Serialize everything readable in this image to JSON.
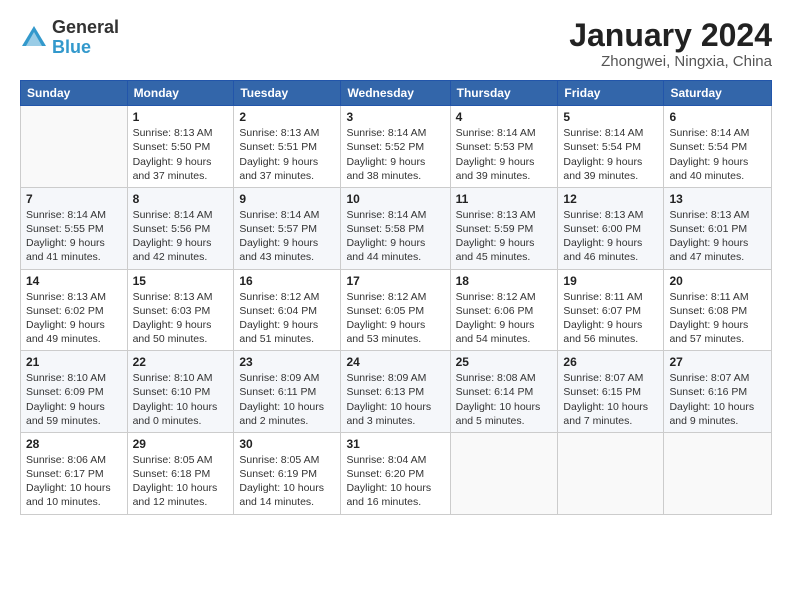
{
  "header": {
    "logo_general": "General",
    "logo_blue": "Blue",
    "title": "January 2024",
    "subtitle": "Zhongwei, Ningxia, China"
  },
  "weekdays": [
    "Sunday",
    "Monday",
    "Tuesday",
    "Wednesday",
    "Thursday",
    "Friday",
    "Saturday"
  ],
  "weeks": [
    [
      {
        "day": "",
        "info": ""
      },
      {
        "day": "1",
        "info": "Sunrise: 8:13 AM\nSunset: 5:50 PM\nDaylight: 9 hours\nand 37 minutes."
      },
      {
        "day": "2",
        "info": "Sunrise: 8:13 AM\nSunset: 5:51 PM\nDaylight: 9 hours\nand 37 minutes."
      },
      {
        "day": "3",
        "info": "Sunrise: 8:14 AM\nSunset: 5:52 PM\nDaylight: 9 hours\nand 38 minutes."
      },
      {
        "day": "4",
        "info": "Sunrise: 8:14 AM\nSunset: 5:53 PM\nDaylight: 9 hours\nand 39 minutes."
      },
      {
        "day": "5",
        "info": "Sunrise: 8:14 AM\nSunset: 5:54 PM\nDaylight: 9 hours\nand 39 minutes."
      },
      {
        "day": "6",
        "info": "Sunrise: 8:14 AM\nSunset: 5:54 PM\nDaylight: 9 hours\nand 40 minutes."
      }
    ],
    [
      {
        "day": "7",
        "info": "Sunrise: 8:14 AM\nSunset: 5:55 PM\nDaylight: 9 hours\nand 41 minutes."
      },
      {
        "day": "8",
        "info": "Sunrise: 8:14 AM\nSunset: 5:56 PM\nDaylight: 9 hours\nand 42 minutes."
      },
      {
        "day": "9",
        "info": "Sunrise: 8:14 AM\nSunset: 5:57 PM\nDaylight: 9 hours\nand 43 minutes."
      },
      {
        "day": "10",
        "info": "Sunrise: 8:14 AM\nSunset: 5:58 PM\nDaylight: 9 hours\nand 44 minutes."
      },
      {
        "day": "11",
        "info": "Sunrise: 8:13 AM\nSunset: 5:59 PM\nDaylight: 9 hours\nand 45 minutes."
      },
      {
        "day": "12",
        "info": "Sunrise: 8:13 AM\nSunset: 6:00 PM\nDaylight: 9 hours\nand 46 minutes."
      },
      {
        "day": "13",
        "info": "Sunrise: 8:13 AM\nSunset: 6:01 PM\nDaylight: 9 hours\nand 47 minutes."
      }
    ],
    [
      {
        "day": "14",
        "info": "Sunrise: 8:13 AM\nSunset: 6:02 PM\nDaylight: 9 hours\nand 49 minutes."
      },
      {
        "day": "15",
        "info": "Sunrise: 8:13 AM\nSunset: 6:03 PM\nDaylight: 9 hours\nand 50 minutes."
      },
      {
        "day": "16",
        "info": "Sunrise: 8:12 AM\nSunset: 6:04 PM\nDaylight: 9 hours\nand 51 minutes."
      },
      {
        "day": "17",
        "info": "Sunrise: 8:12 AM\nSunset: 6:05 PM\nDaylight: 9 hours\nand 53 minutes."
      },
      {
        "day": "18",
        "info": "Sunrise: 8:12 AM\nSunset: 6:06 PM\nDaylight: 9 hours\nand 54 minutes."
      },
      {
        "day": "19",
        "info": "Sunrise: 8:11 AM\nSunset: 6:07 PM\nDaylight: 9 hours\nand 56 minutes."
      },
      {
        "day": "20",
        "info": "Sunrise: 8:11 AM\nSunset: 6:08 PM\nDaylight: 9 hours\nand 57 minutes."
      }
    ],
    [
      {
        "day": "21",
        "info": "Sunrise: 8:10 AM\nSunset: 6:09 PM\nDaylight: 9 hours\nand 59 minutes."
      },
      {
        "day": "22",
        "info": "Sunrise: 8:10 AM\nSunset: 6:10 PM\nDaylight: 10 hours\nand 0 minutes."
      },
      {
        "day": "23",
        "info": "Sunrise: 8:09 AM\nSunset: 6:11 PM\nDaylight: 10 hours\nand 2 minutes."
      },
      {
        "day": "24",
        "info": "Sunrise: 8:09 AM\nSunset: 6:13 PM\nDaylight: 10 hours\nand 3 minutes."
      },
      {
        "day": "25",
        "info": "Sunrise: 8:08 AM\nSunset: 6:14 PM\nDaylight: 10 hours\nand 5 minutes."
      },
      {
        "day": "26",
        "info": "Sunrise: 8:07 AM\nSunset: 6:15 PM\nDaylight: 10 hours\nand 7 minutes."
      },
      {
        "day": "27",
        "info": "Sunrise: 8:07 AM\nSunset: 6:16 PM\nDaylight: 10 hours\nand 9 minutes."
      }
    ],
    [
      {
        "day": "28",
        "info": "Sunrise: 8:06 AM\nSunset: 6:17 PM\nDaylight: 10 hours\nand 10 minutes."
      },
      {
        "day": "29",
        "info": "Sunrise: 8:05 AM\nSunset: 6:18 PM\nDaylight: 10 hours\nand 12 minutes."
      },
      {
        "day": "30",
        "info": "Sunrise: 8:05 AM\nSunset: 6:19 PM\nDaylight: 10 hours\nand 14 minutes."
      },
      {
        "day": "31",
        "info": "Sunrise: 8:04 AM\nSunset: 6:20 PM\nDaylight: 10 hours\nand 16 minutes."
      },
      {
        "day": "",
        "info": ""
      },
      {
        "day": "",
        "info": ""
      },
      {
        "day": "",
        "info": ""
      }
    ]
  ]
}
